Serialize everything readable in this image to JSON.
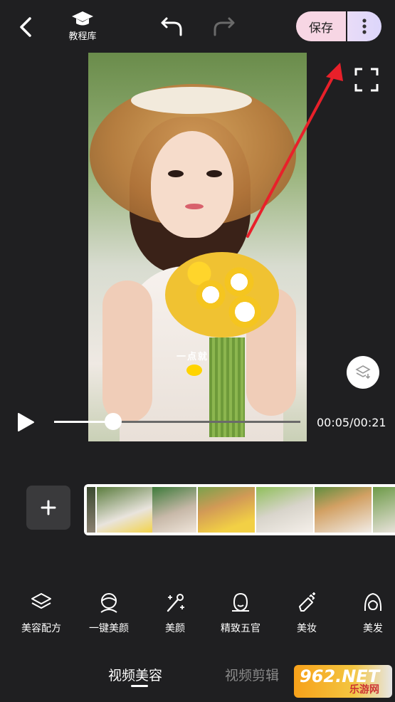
{
  "header": {
    "tutorial_label": "教程库",
    "save_label": "保存"
  },
  "video": {
    "caption": "一点就",
    "time": "00:05/00:21"
  },
  "playback": {
    "progress": 0.24
  },
  "tools": [
    {
      "label": "美容配方",
      "icon": "layers-icon"
    },
    {
      "label": "一键美颜",
      "icon": "face-icon"
    },
    {
      "label": "美颜",
      "icon": "magic-wand-icon"
    },
    {
      "label": "精致五官",
      "icon": "face-outline-icon"
    },
    {
      "label": "美妆",
      "icon": "makeup-icon"
    },
    {
      "label": "美发",
      "icon": "hair-icon"
    }
  ],
  "tabs": {
    "active": "视频美容",
    "inactive": "视频剪辑"
  },
  "watermark": {
    "brand": "962.NET",
    "sub": "乐游网"
  }
}
